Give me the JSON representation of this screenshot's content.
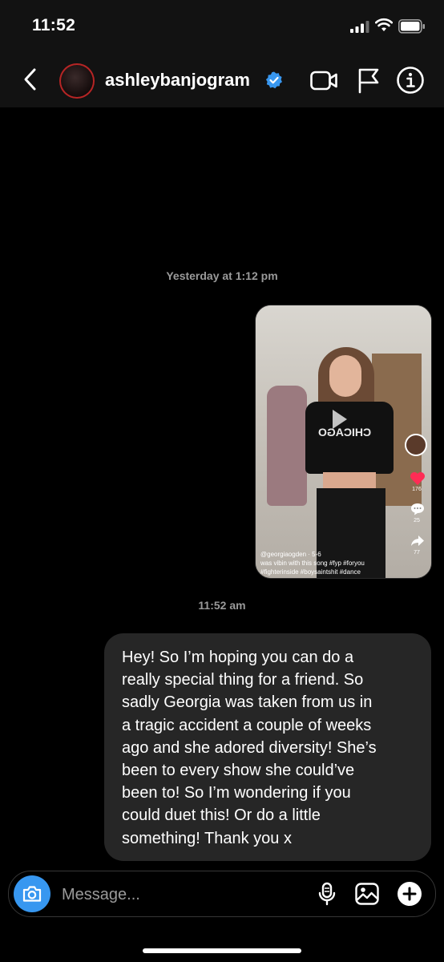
{
  "status_bar": {
    "time": "11:52"
  },
  "header": {
    "username": "ashleybanjogram"
  },
  "thread": {
    "timestamp_1": "Yesterday at 1:12 pm",
    "shared_post": {
      "username": "@georgiaogden",
      "date": "5-6",
      "caption_line1": "was vibin with this song #fyp #foryou",
      "caption_line2": "#fighterinside #boysaintshit #dance",
      "shirt_text": "CHICAGO",
      "likes": "176",
      "comments": "25",
      "shares": "77"
    },
    "timestamp_2": "11:52 am",
    "message": "Hey! So I’m hoping you can do a\nreally special thing for a friend. So\nsadly Georgia was taken from us in\na tragic accident a couple of weeks\nago and she adored diversity! She’s\nbeen to every show she could’ve\nbeen to! So I’m wondering if you\ncould duet this! Or do a little\nsomething! Thank you x"
  },
  "composer": {
    "placeholder": "Message...",
    "value": ""
  },
  "colors": {
    "background": "#000000",
    "bar": "#121212",
    "bubble": "#262626",
    "accent_blue": "#3797f0",
    "verified": "#3897f0",
    "heart": "#fe2c55"
  },
  "icons": [
    "back-chevron-icon",
    "verified-badge-icon",
    "video-call-icon",
    "flag-icon",
    "info-icon",
    "camera-icon",
    "microphone-icon",
    "gallery-icon",
    "plus-icon"
  ]
}
